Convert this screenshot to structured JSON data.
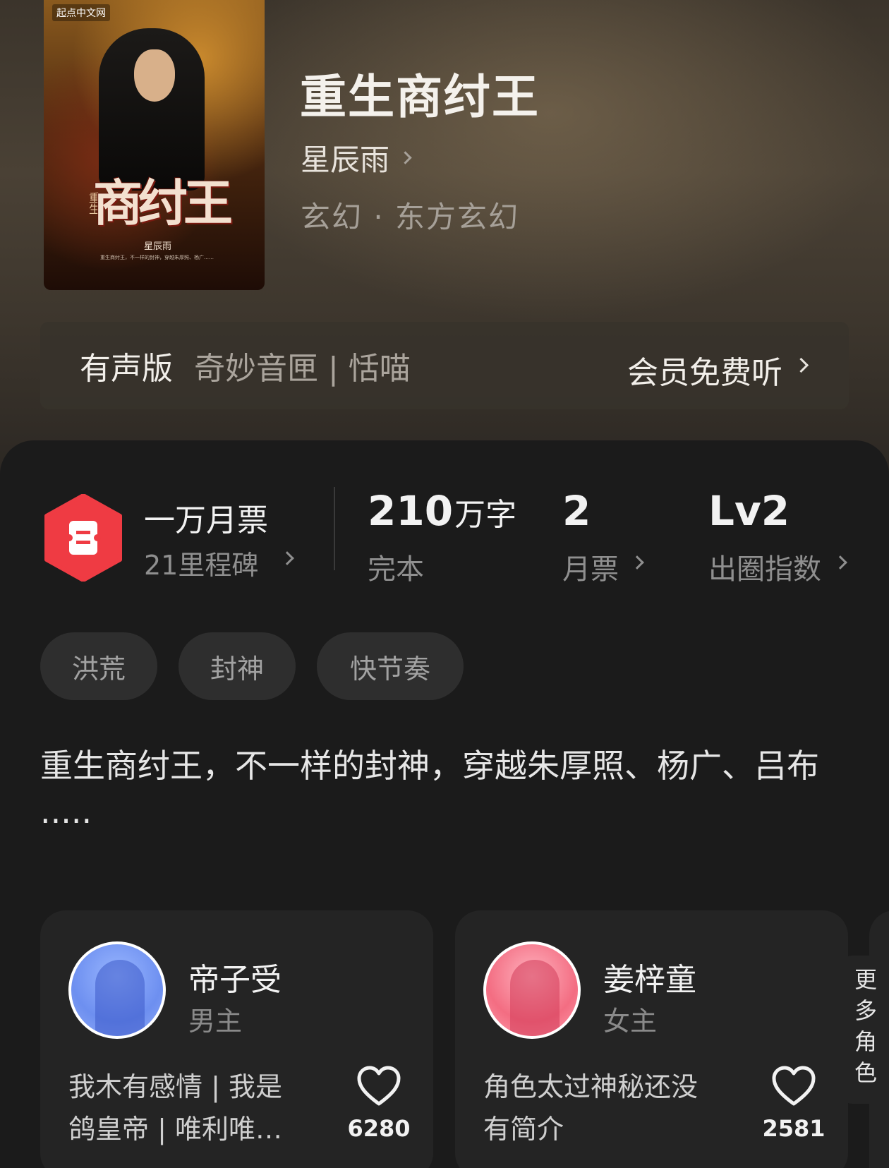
{
  "book": {
    "title": "重生商纣王",
    "author": "星辰雨",
    "genre": "玄幻 · 东方玄幻",
    "cover": {
      "publisher": "起点中文网",
      "title_art": "商纣王",
      "subtitle_art": "重生",
      "author": "星辰雨",
      "blurb": "重生商纣王，不一样的封神，穿越朱厚照、杨广……"
    }
  },
  "audio": {
    "label": "有声版",
    "source": "奇妙音匣 | 恬喵",
    "action": "会员免费听"
  },
  "stats": {
    "ticket": {
      "main": "一万月票",
      "sub": "21里程碑"
    },
    "words": {
      "value": "210",
      "unit": "万字",
      "label": "完本"
    },
    "monthly": {
      "value": "2",
      "label": "月票"
    },
    "circle": {
      "value": "Lv2",
      "label": "出圈指数"
    }
  },
  "tags": [
    "洪荒",
    "封神",
    "快节奏"
  ],
  "description": "重生商纣王，不一样的封神，穿越朱厚照、杨广、吕布·····",
  "characters": [
    {
      "name": "帝子受",
      "role": "男主",
      "desc": "我木有感情 | 我是鸽皇帝 | 唯利唯…",
      "likes": "6280"
    },
    {
      "name": "姜梓童",
      "role": "女主",
      "desc": "角色太过神秘还没有简介",
      "likes": "2581"
    }
  ],
  "more_roles": "更多角色",
  "colors": {
    "ticket_red": "#ef3b43",
    "background": "#1b1b1b"
  }
}
